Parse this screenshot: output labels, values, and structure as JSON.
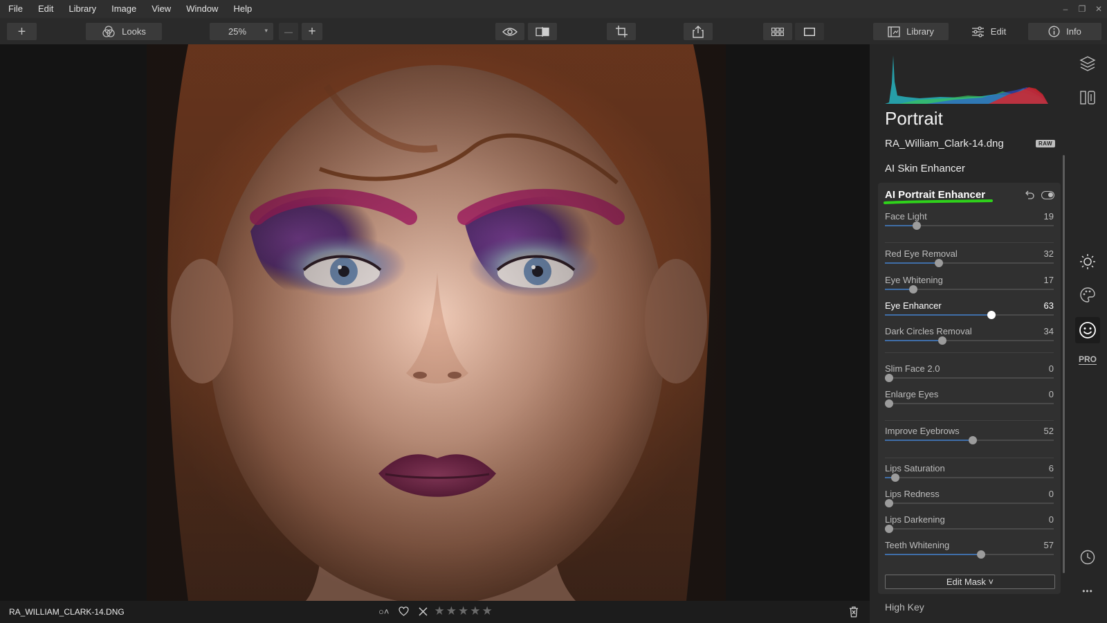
{
  "menu": [
    "File",
    "Edit",
    "Library",
    "Image",
    "View",
    "Window",
    "Help"
  ],
  "window_controls": [
    "–",
    "❐",
    "✕"
  ],
  "toolbar": {
    "add_label": "+",
    "looks_label": "Looks",
    "zoom_value": "25%",
    "zoom_out": "—",
    "zoom_in": "+",
    "tabs": [
      {
        "label": "Library",
        "icon": "library-icon",
        "active": false
      },
      {
        "label": "Edit",
        "icon": "sliders-icon",
        "active": true
      },
      {
        "label": "Info",
        "icon": "info-icon",
        "active": false
      }
    ]
  },
  "statusbar": {
    "filename": "RA_WILLIAM_CLARK-14.DNG",
    "rating_stars": 0,
    "max_stars": 5,
    "star_glyph": "★"
  },
  "panel": {
    "preset_title": "Portrait",
    "file_name": "RA_William_Clark-14.dng",
    "raw_badge": "RAW",
    "skin_section": "AI Skin Enhancer",
    "module": {
      "title": "AI Portrait Enhancer",
      "underline_color": "#2fd21b",
      "enabled": true,
      "sliders": [
        {
          "label": "Face Light",
          "value": 19,
          "active": false
        },
        {
          "label": "Red Eye Removal",
          "value": 32,
          "active": false
        },
        {
          "label": "Eye Whitening",
          "value": 17,
          "active": false
        },
        {
          "label": "Eye Enhancer",
          "value": 63,
          "active": true
        },
        {
          "label": "Dark Circles Removal",
          "value": 34,
          "active": false
        },
        {
          "label": "Slim Face 2.0",
          "value": 0,
          "active": false
        },
        {
          "label": "Enlarge Eyes",
          "value": 0,
          "active": false
        },
        {
          "label": "Improve Eyebrows",
          "value": 52,
          "active": false
        },
        {
          "label": "Lips Saturation",
          "value": 6,
          "active": false
        },
        {
          "label": "Lips Redness",
          "value": 0,
          "active": false
        },
        {
          "label": "Lips Darkening",
          "value": 0,
          "active": false
        },
        {
          "label": "Teeth Whitening",
          "value": 57,
          "active": false
        }
      ],
      "edit_mask_label": "Edit Mask ˅"
    },
    "next_section": "High Key"
  },
  "rail": {
    "icons": [
      "layers-icon",
      "presets-icon",
      "sun-icon",
      "palette-icon",
      "face-icon",
      "pro-icon",
      "history-icon",
      "more-icon"
    ],
    "pro_label": "PRO",
    "more_label": "•••"
  },
  "colors": {
    "accent": "#3f6ea8",
    "highlight_green": "#2fd21b"
  }
}
